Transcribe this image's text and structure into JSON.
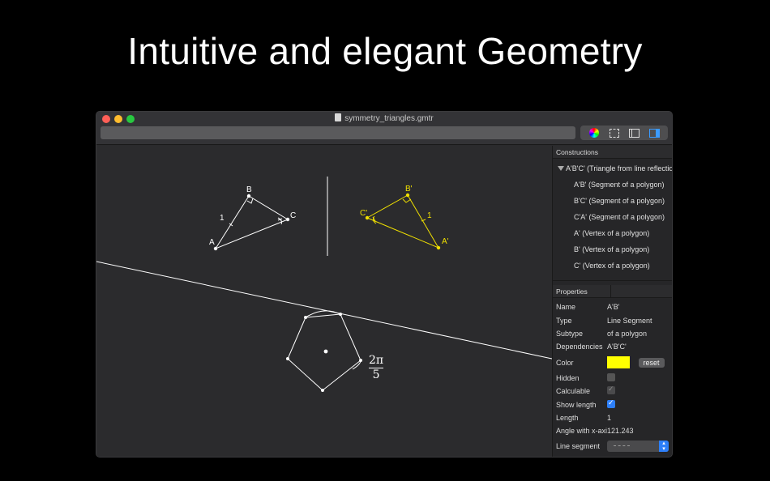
{
  "headline": "Intuitive and elegant Geometry",
  "window": {
    "title": "symmetry_triangles.gmtr",
    "toolbar": {
      "icons": [
        "color-wheel-icon",
        "selection-icon",
        "left-sidebar-icon",
        "right-sidebar-icon"
      ]
    }
  },
  "canvas": {
    "original_triangle": {
      "vertices": {
        "A": "A",
        "B": "B",
        "C": "C"
      },
      "side_label": "1",
      "color": "#ffffff"
    },
    "reflected_triangle": {
      "vertices": {
        "A": "A'",
        "B": "B'",
        "C": "C'"
      },
      "side_label": "1",
      "color": "#f0e000"
    },
    "angle_label": {
      "numerator": "2π",
      "denominator": "5"
    }
  },
  "constructions": {
    "header": "Constructions",
    "parent": "A'B'C' (Triangle from line reflection)",
    "children": [
      "A'B' (Segment of a polygon)",
      "B'C' (Segment of a polygon)",
      "C'A' (Segment of a polygon)",
      "A' (Vertex of a polygon)",
      "B' (Vertex of a polygon)",
      "C' (Vertex of a polygon)"
    ]
  },
  "properties": {
    "header": "Properties",
    "name_label": "Name",
    "name_value": "A'B'",
    "type_label": "Type",
    "type_value": "Line Segment",
    "subtype_label": "Subtype",
    "subtype_value": "of a polygon",
    "dependencies_label": "Dependencies",
    "dependencies_value": "A'B'C'",
    "color_label": "Color",
    "color_value": "#ffff00",
    "reset_label": "reset",
    "hidden_label": "Hidden",
    "hidden_checked": false,
    "calculable_label": "Calculable",
    "calculable_checked": true,
    "show_length_label": "Show length",
    "show_length_checked": true,
    "length_label": "Length",
    "length_value": "1",
    "angle_label": "Angle with x-axis",
    "angle_value": "121.243",
    "line_segment_label": "Line segment"
  }
}
